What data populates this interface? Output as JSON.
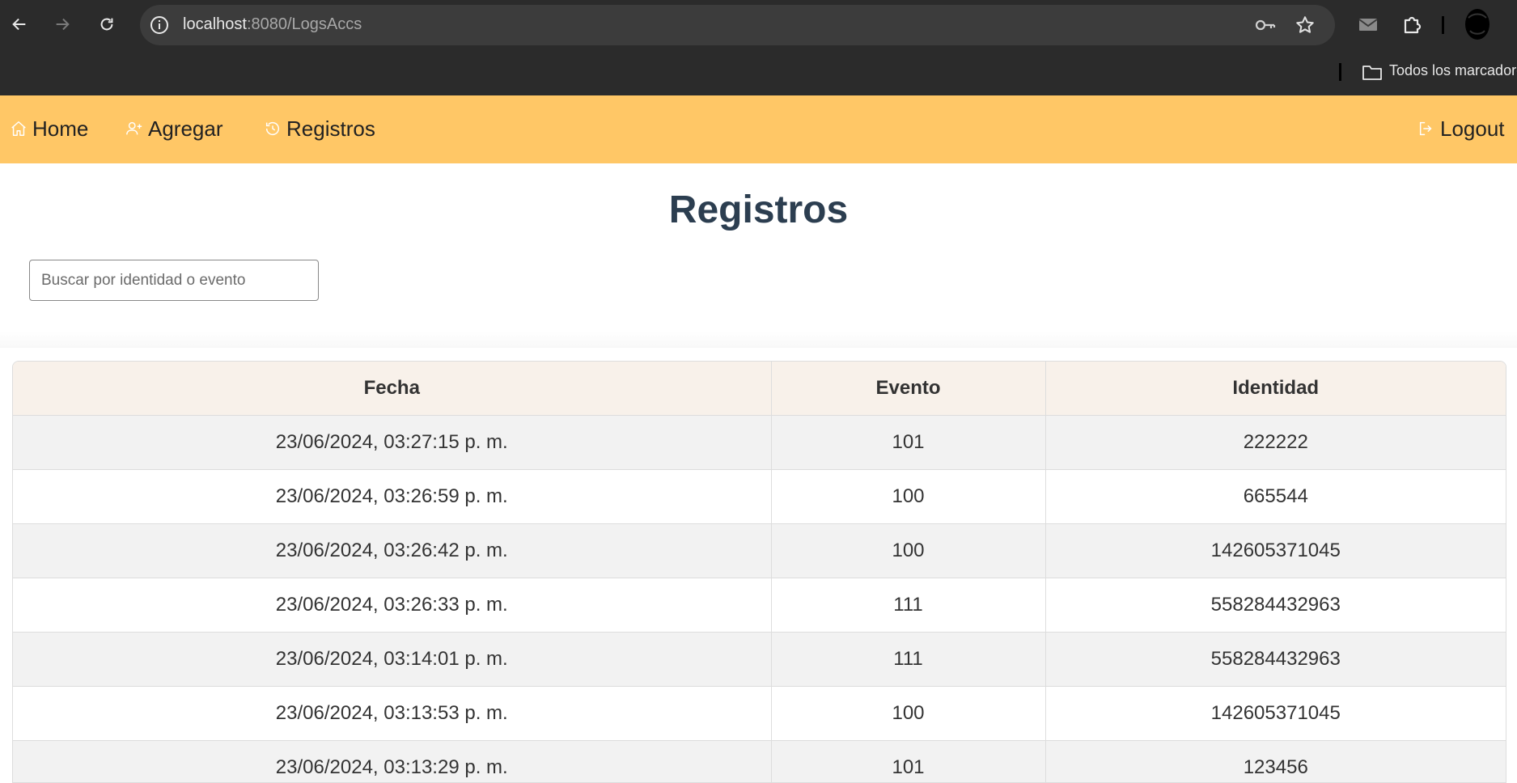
{
  "browser": {
    "url_host": "localhost",
    "url_path": ":8080/LogsAccs",
    "bookmarks_label": "Todos los marcadores"
  },
  "nav": {
    "home": "Home",
    "agregar": "Agregar",
    "registros": "Registros",
    "logout": "Logout"
  },
  "page": {
    "title": "Registros",
    "search_placeholder": "Buscar por identidad o evento"
  },
  "table": {
    "headers": [
      "Fecha",
      "Evento",
      "Identidad"
    ],
    "rows": [
      [
        "23/06/2024, 03:27:15 p. m.",
        "101",
        "222222"
      ],
      [
        "23/06/2024, 03:26:59 p. m.",
        "100",
        "665544"
      ],
      [
        "23/06/2024, 03:26:42 p. m.",
        "100",
        "142605371045"
      ],
      [
        "23/06/2024, 03:26:33 p. m.",
        "111",
        "558284432963"
      ],
      [
        "23/06/2024, 03:14:01 p. m.",
        "111",
        "558284432963"
      ],
      [
        "23/06/2024, 03:13:53 p. m.",
        "100",
        "142605371045"
      ],
      [
        "23/06/2024, 03:13:29 p. m.",
        "101",
        "123456"
      ]
    ]
  },
  "colors": {
    "navbar": "#ffc766",
    "title": "#2c3e50",
    "header_bg": "#f8f1ea",
    "row_alt": "#f2f2f2"
  }
}
